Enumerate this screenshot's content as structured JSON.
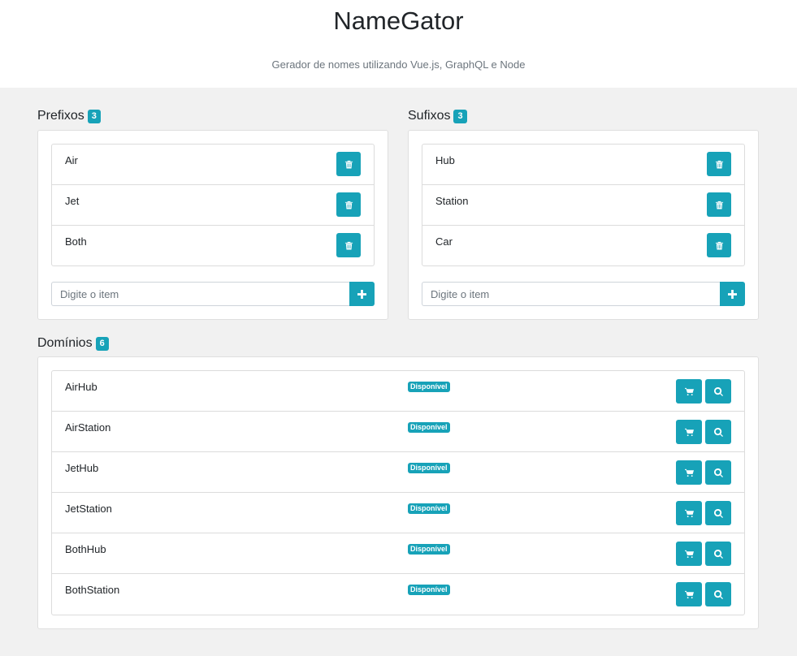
{
  "app": {
    "title": "NameGator",
    "subtitle": "Gerador de nomes utilizando Vue.js, GraphQL e Node"
  },
  "prefixes": {
    "title": "Prefixos",
    "count": "3",
    "items": [
      {
        "label": "Air"
      },
      {
        "label": "Jet"
      },
      {
        "label": "Both"
      }
    ],
    "placeholder": "Digite o item"
  },
  "suffixes": {
    "title": "Sufixos",
    "count": "3",
    "items": [
      {
        "label": "Hub"
      },
      {
        "label": "Station"
      },
      {
        "label": "Car"
      }
    ],
    "placeholder": "Digite o item"
  },
  "domains": {
    "title": "Domínios",
    "count": "6",
    "items": [
      {
        "name": "AirHub",
        "status": "Disponível"
      },
      {
        "name": "AirStation",
        "status": "Disponível"
      },
      {
        "name": "JetHub",
        "status": "Disponível"
      },
      {
        "name": "JetStation",
        "status": "Disponível"
      },
      {
        "name": "BothHub",
        "status": "Disponível"
      },
      {
        "name": "BothStation",
        "status": "Disponível"
      }
    ]
  },
  "icons": {
    "delete": "trash-icon",
    "add": "plus-icon",
    "cart": "cart-icon",
    "search": "search-icon"
  },
  "colors": {
    "accent": "#17a2b8",
    "background": "#f1f1f1"
  }
}
